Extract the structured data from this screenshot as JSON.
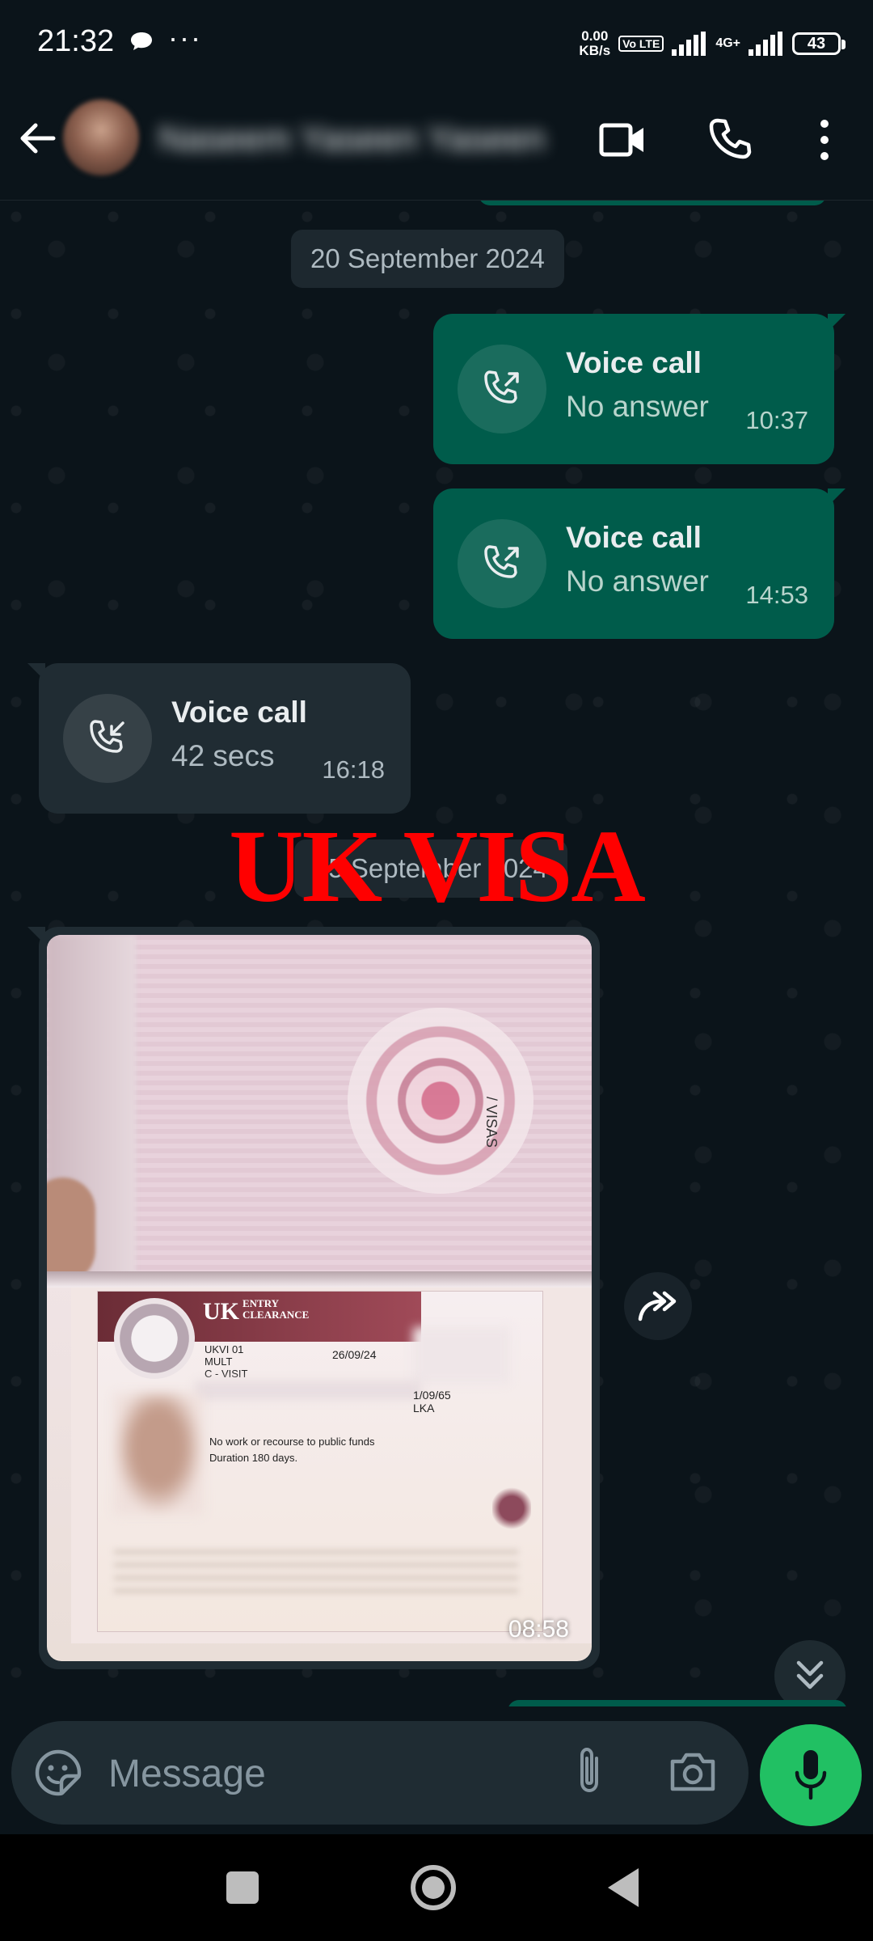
{
  "status_bar": {
    "time": "21:32",
    "dots": "···",
    "net_speed_value": "0.00",
    "net_speed_unit": "KB/s",
    "volte": "Vo LTE",
    "network": "4G+",
    "battery": "43"
  },
  "header": {
    "contact_name": "Naseem Yaseen Yaseen"
  },
  "chat": {
    "date_1": "20 September 2024",
    "date_2": "25 September 2024",
    "calls": [
      {
        "title": "Voice call",
        "subtitle": "No answer",
        "time": "10:37",
        "direction": "outgoing"
      },
      {
        "title": "Voice call",
        "subtitle": "No answer",
        "time": "14:53",
        "direction": "outgoing"
      },
      {
        "title": "Voice call",
        "subtitle": "42 secs",
        "time": "16:18",
        "direction": "incoming"
      }
    ],
    "overlay_text": "UK VISA",
    "image_message": {
      "time": "08:58",
      "visa": {
        "header": "UK",
        "header_small_1": "ENTRY",
        "header_small_2": "CLEARANCE",
        "place_of_issue": "UKVI 01",
        "entries": "MULT",
        "type": "C - VISIT",
        "valid_from": "26/09/24",
        "remarks_1": "No work or recourse to public funds",
        "remarks_2": "Duration 180 days.",
        "nationality": "LKA",
        "dob_fragment": "1/09/65",
        "page_label": "/ VISAS"
      }
    }
  },
  "input": {
    "placeholder": "Message"
  },
  "colors": {
    "background": "#0b141a",
    "outgoing_bubble": "#005c4b",
    "incoming_bubble": "#202c33",
    "mic_button": "#21c063",
    "overlay_text": "#ff0000"
  }
}
